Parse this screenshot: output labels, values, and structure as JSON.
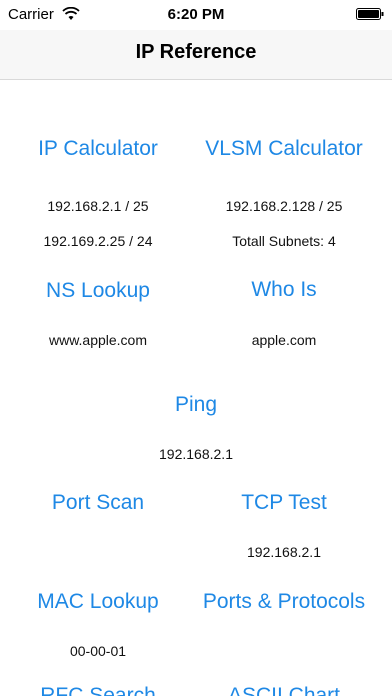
{
  "status": {
    "carrier": "Carrier",
    "time": "6:20 PM"
  },
  "nav": {
    "title": "IP Reference"
  },
  "tools": {
    "ip_calculator": {
      "label": "IP Calculator",
      "lines": [
        "192.168.2.1 / 25",
        "192.169.2.25 / 24"
      ]
    },
    "vlsm_calculator": {
      "label": "VLSM Calculator",
      "lines": [
        "192.168.2.128 / 25",
        "Totall Subnets: 4"
      ]
    },
    "ns_lookup": {
      "label": "NS Lookup",
      "lines": [
        "www.apple.com"
      ]
    },
    "who_is": {
      "label": "Who Is",
      "lines": [
        "apple.com"
      ]
    },
    "ping": {
      "label": "Ping",
      "lines": [
        "192.168.2.1"
      ]
    },
    "port_scan": {
      "label": "Port Scan"
    },
    "tcp_test": {
      "label": "TCP Test",
      "lines": [
        "192.168.2.1"
      ]
    },
    "mac_lookup": {
      "label": "MAC Lookup",
      "lines": [
        "00-00-01"
      ]
    },
    "ports_protocols": {
      "label": "Ports & Protocols"
    },
    "rfc_search": {
      "label": "RFC Search"
    },
    "ascii_chart": {
      "label": "ASCII Chart"
    }
  },
  "colors": {
    "accent": "#1e88e5",
    "nav_background": "#f7f7f7"
  },
  "icons": [
    "wifi-icon",
    "battery-icon"
  ]
}
